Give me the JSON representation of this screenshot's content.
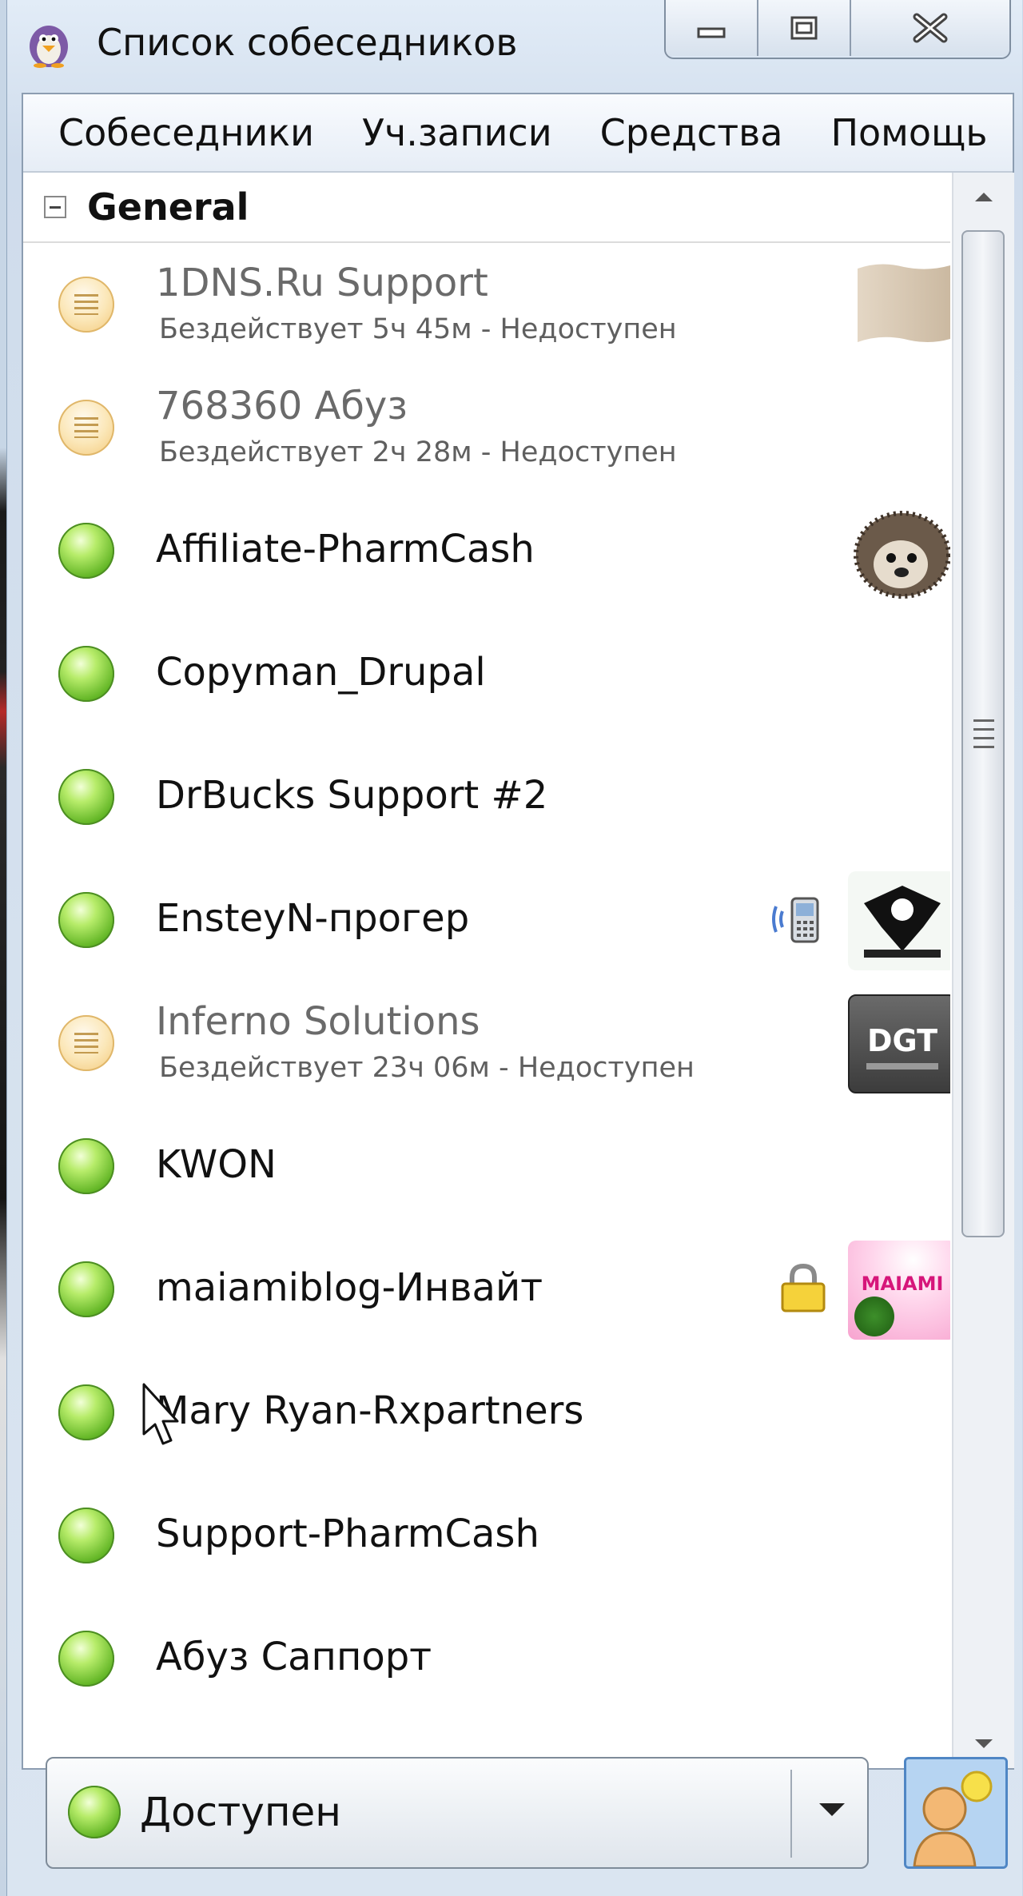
{
  "window": {
    "title": "Список собеседников"
  },
  "menu": [
    "Собеседники",
    "Уч.записи",
    "Средства",
    "Помощь"
  ],
  "group": {
    "name": "General"
  },
  "contacts": [
    {
      "name": "1DNS.Ru Support",
      "status": "idle",
      "sub": "Бездействует 5ч 45м - Недоступен"
    },
    {
      "name": "768360 Абуз",
      "status": "idle",
      "sub": "Бездействует 2ч 28м - Недоступен"
    },
    {
      "name": "Affiliate-PharmCash",
      "status": "available"
    },
    {
      "name": "Copyman_Drupal",
      "status": "available"
    },
    {
      "name": "DrBucks Support #2",
      "status": "available"
    },
    {
      "name": "EnsteyN-прогер",
      "status": "available",
      "extra_icon": "mobile-phone-icon"
    },
    {
      "name": "Inferno Solutions",
      "status": "idle",
      "sub": "Бездействует 23ч 06м - Недоступен",
      "avatar_text": "DGT"
    },
    {
      "name": "KWON",
      "status": "available"
    },
    {
      "name": "maiamiblog-Инвайт",
      "status": "available",
      "extra_icon": "lock-icon",
      "avatar_text": "MAIAMI"
    },
    {
      "name": "Mary Ryan-Rxpartners",
      "status": "available"
    },
    {
      "name": "Support-PharmCash",
      "status": "available"
    },
    {
      "name": "Абуз Саппорт",
      "status": "available"
    }
  ],
  "status_selector": {
    "label": "Доступен"
  },
  "colors": {
    "available": "#63b626",
    "idle": "#f3c879",
    "accent": "#4f86c4"
  }
}
